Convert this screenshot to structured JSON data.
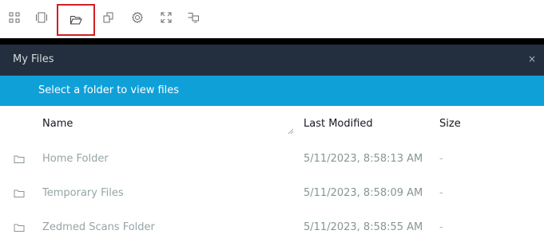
{
  "toolbar": {
    "buttons": [
      {
        "icon": "grid-icon",
        "selected": false
      },
      {
        "icon": "window-icon",
        "selected": false
      },
      {
        "icon": "folder-open-icon",
        "selected": true
      },
      {
        "icon": "copy-icon",
        "selected": false
      },
      {
        "icon": "gear-icon",
        "selected": false
      },
      {
        "icon": "fullscreen-icon",
        "selected": false
      },
      {
        "icon": "multi-monitor-icon",
        "selected": false
      }
    ],
    "selected_outline_color": "#d11f26"
  },
  "panel": {
    "title": "My Files",
    "close_label": "×",
    "banner_text": "Select a folder to view files",
    "banner_color": "#10a0d8",
    "header_color": "#232f3e"
  },
  "table": {
    "columns": [
      "Name",
      "Last Modified",
      "Size"
    ],
    "rows": [
      {
        "name": "Home Folder",
        "modified": "5/11/2023, 8:58:13 AM",
        "size": "-"
      },
      {
        "name": "Temporary Files",
        "modified": "5/11/2023, 8:58:09 AM",
        "size": "-"
      },
      {
        "name": "Zedmed Scans Folder",
        "modified": "5/11/2023, 8:58:55 AM",
        "size": "-"
      }
    ]
  }
}
